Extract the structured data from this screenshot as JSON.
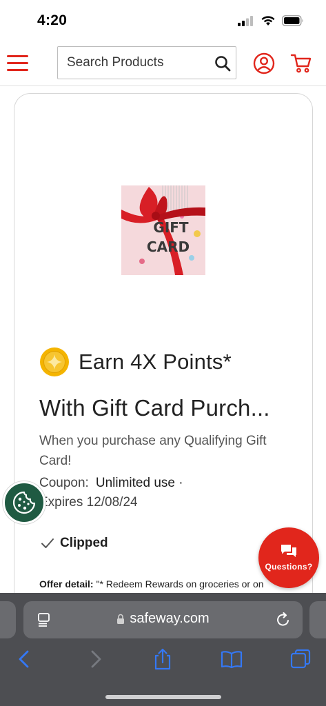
{
  "status_bar": {
    "time": "4:20"
  },
  "header": {
    "search": {
      "placeholder": "Search Products"
    }
  },
  "offer": {
    "earn_label": "Earn 4X Points*",
    "title": "With Gift Card Purch...",
    "description": "When you purchase any Qualifying Gift Card!",
    "coupon_label": "Coupon:",
    "coupon_value": "Unlimited use ·",
    "expires": "Expires 12/08/24",
    "clipped": "Clipped",
    "detail_label": "Offer detail:",
    "detail_text": " \"* Redeem Rewards on groceries or on"
  },
  "image": {
    "logo_text_line1": "GIFT",
    "logo_text_line2": "CARD"
  },
  "help": {
    "questions_label": "Questions?"
  },
  "browser": {
    "url": "safeway.com"
  },
  "colors": {
    "brand_red": "#e1261c",
    "cookie_green": "#1f5a42",
    "coin_gold": "#f4b400",
    "safari_bar": "#4d4e52",
    "safari_blue": "#3478f6"
  },
  "icons": [
    "menu-icon",
    "search-icon",
    "account-icon",
    "cart-icon",
    "coin-icon",
    "check-icon",
    "cookie-icon",
    "chat-icon",
    "reader-icon",
    "lock-icon",
    "reload-icon",
    "back-icon",
    "forward-icon",
    "share-icon",
    "bookmarks-icon",
    "tabs-icon"
  ]
}
